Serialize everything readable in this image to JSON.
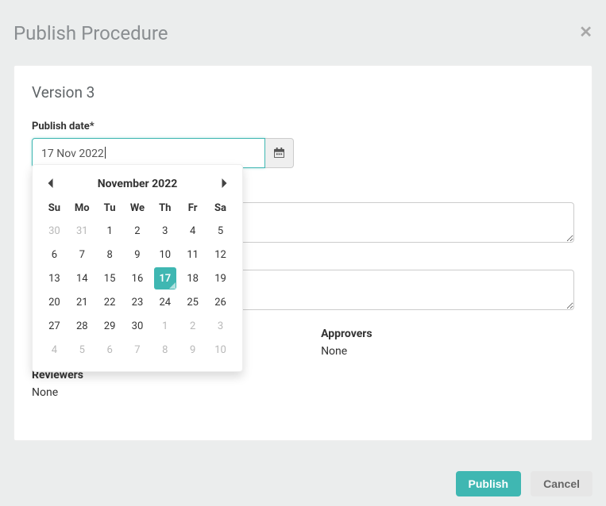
{
  "modal": {
    "title": "Publish Procedure"
  },
  "panel": {
    "version_title": "Version 3",
    "publish_date_label": "Publish date*",
    "publish_date_value": "17 Nov 2022",
    "approvers_label": "Approvers",
    "approvers_value": "None",
    "reviewers_label": "Reviewers",
    "reviewers_value": "None"
  },
  "calendar": {
    "month_title": "November 2022",
    "dow": [
      "Su",
      "Mo",
      "Tu",
      "We",
      "Th",
      "Fr",
      "Sa"
    ],
    "weeks": [
      [
        {
          "d": "30",
          "o": true
        },
        {
          "d": "31",
          "o": true
        },
        {
          "d": "1"
        },
        {
          "d": "2"
        },
        {
          "d": "3"
        },
        {
          "d": "4"
        },
        {
          "d": "5"
        }
      ],
      [
        {
          "d": "6"
        },
        {
          "d": "7"
        },
        {
          "d": "8"
        },
        {
          "d": "9"
        },
        {
          "d": "10"
        },
        {
          "d": "11"
        },
        {
          "d": "12"
        }
      ],
      [
        {
          "d": "13"
        },
        {
          "d": "14"
        },
        {
          "d": "15"
        },
        {
          "d": "16"
        },
        {
          "d": "17",
          "sel": true
        },
        {
          "d": "18"
        },
        {
          "d": "19"
        }
      ],
      [
        {
          "d": "20"
        },
        {
          "d": "21"
        },
        {
          "d": "22"
        },
        {
          "d": "23"
        },
        {
          "d": "24"
        },
        {
          "d": "25"
        },
        {
          "d": "26"
        }
      ],
      [
        {
          "d": "27"
        },
        {
          "d": "28"
        },
        {
          "d": "29"
        },
        {
          "d": "30"
        },
        {
          "d": "1",
          "o": true
        },
        {
          "d": "2",
          "o": true
        },
        {
          "d": "3",
          "o": true
        }
      ],
      [
        {
          "d": "4",
          "o": true
        },
        {
          "d": "5",
          "o": true
        },
        {
          "d": "6",
          "o": true
        },
        {
          "d": "7",
          "o": true
        },
        {
          "d": "8",
          "o": true
        },
        {
          "d": "9",
          "o": true
        },
        {
          "d": "10",
          "o": true
        }
      ]
    ]
  },
  "footer": {
    "publish": "Publish",
    "cancel": "Cancel"
  }
}
